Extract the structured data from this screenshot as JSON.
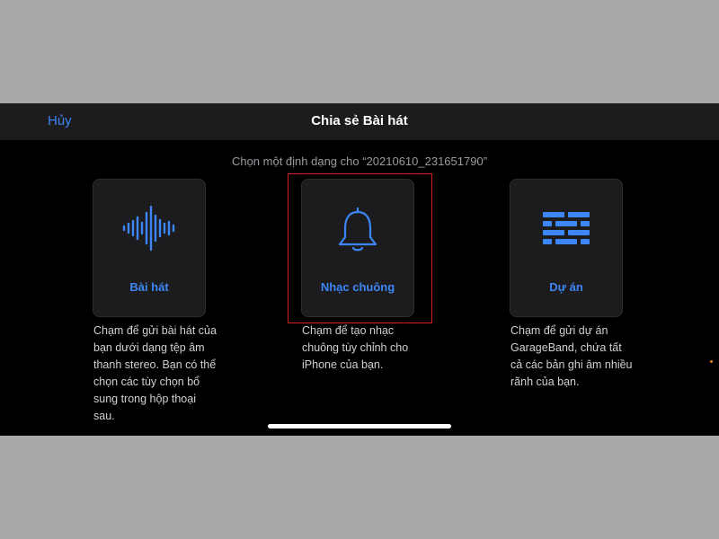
{
  "navbar": {
    "cancel_label": "Hủy",
    "title": "Chia sẻ Bài hát"
  },
  "subtitle": "Chọn một định dạng cho “20210610_231651790”",
  "options": [
    {
      "label": "Bài hát",
      "icon": "waveform-icon",
      "description": "Chạm để gửi bài hát của bạn dưới dạng tệp âm thanh stereo. Bạn có thể chọn các tùy chọn bổ sung trong hộp thoại sau."
    },
    {
      "label": "Nhạc chuông",
      "icon": "bell-icon",
      "description": "Chạm để tạo nhạc chuông tùy chỉnh cho iPhone của bạn."
    },
    {
      "label": "Dự án",
      "icon": "bricks-icon",
      "description": "Chạm để gửi dự án GarageBand, chứa tất cả các bản ghi âm nhiều rãnh của bạn."
    }
  ],
  "colors": {
    "accent": "#3d86f5",
    "highlight_border": "#d62020",
    "background": "#000000",
    "card": "#1c1c1e"
  }
}
